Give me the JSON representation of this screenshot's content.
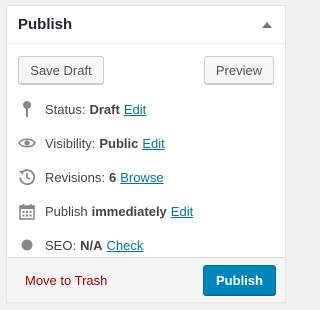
{
  "panel": {
    "title": "Publish",
    "toggle_icon": "triangle-up-icon"
  },
  "buttons": {
    "save_draft": "Save Draft",
    "preview": "Preview",
    "publish": "Publish",
    "trash": "Move to Trash"
  },
  "rows": {
    "status": {
      "icon": "pin-icon",
      "label": "Status:",
      "value": "Draft",
      "link": "Edit"
    },
    "visibility": {
      "icon": "eye-icon",
      "label": "Visibility:",
      "value": "Public",
      "link": "Edit"
    },
    "revisions": {
      "icon": "history-icon",
      "label": "Revisions:",
      "value": "6",
      "link": "Browse"
    },
    "publish_time": {
      "icon": "calendar-icon",
      "label": "Publish",
      "value": "immediately",
      "link": "Edit"
    },
    "seo": {
      "icon": "dot-icon",
      "label": "SEO:",
      "value": "N/A",
      "link": "Check"
    }
  },
  "colors": {
    "link": "#0073aa",
    "trash": "#aa0000",
    "publish_bg": "#0085ba",
    "seo_dot": "#888888"
  }
}
